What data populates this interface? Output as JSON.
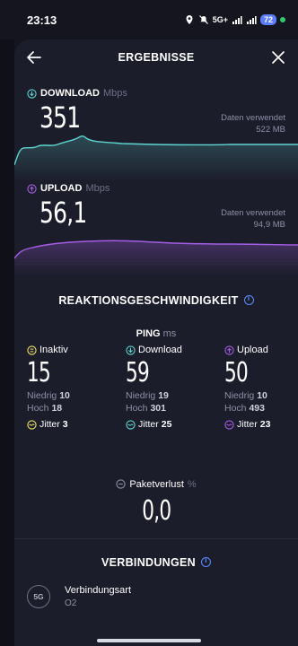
{
  "status": {
    "time": "23:13",
    "network": "5G+",
    "battery": "72"
  },
  "header": {
    "title": "ERGEBNISSE"
  },
  "download": {
    "label": "DOWNLOAD",
    "unit": "Mbps",
    "value": "351",
    "used_label": "Daten verwendet",
    "used_value": "522 MB",
    "color": "#5fd4d0"
  },
  "upload": {
    "label": "UPLOAD",
    "unit": "Mbps",
    "value": "56,1",
    "used_label": "Daten verwendet",
    "used_value": "94,9 MB",
    "color": "#a45ee5"
  },
  "reaction": {
    "title": "REAKTIONSGESCHWINDIGKEIT"
  },
  "ping": {
    "label": "PING",
    "unit": "ms",
    "columns": [
      {
        "label": "Inaktiv",
        "value": "15",
        "low_label": "Niedrig",
        "low": "10",
        "high_label": "Hoch",
        "high": "18",
        "jitter_label": "Jitter",
        "jitter": "3",
        "color": "#f0e26a"
      },
      {
        "label": "Download",
        "value": "59",
        "low_label": "Niedrig",
        "low": "19",
        "high_label": "Hoch",
        "high": "301",
        "jitter_label": "Jitter",
        "jitter": "25",
        "color": "#5fd4d0"
      },
      {
        "label": "Upload",
        "value": "50",
        "low_label": "Niedrig",
        "low": "10",
        "high_label": "Hoch",
        "high": "493",
        "jitter_label": "Jitter",
        "jitter": "23",
        "color": "#a45ee5"
      }
    ]
  },
  "packet_loss": {
    "label": "Paketverlust",
    "unit": "%",
    "value": "0,0"
  },
  "connections": {
    "title": "VERBINDUNGEN",
    "type_label": "Verbindungsart",
    "type_value": "O2",
    "badge": "5G"
  }
}
